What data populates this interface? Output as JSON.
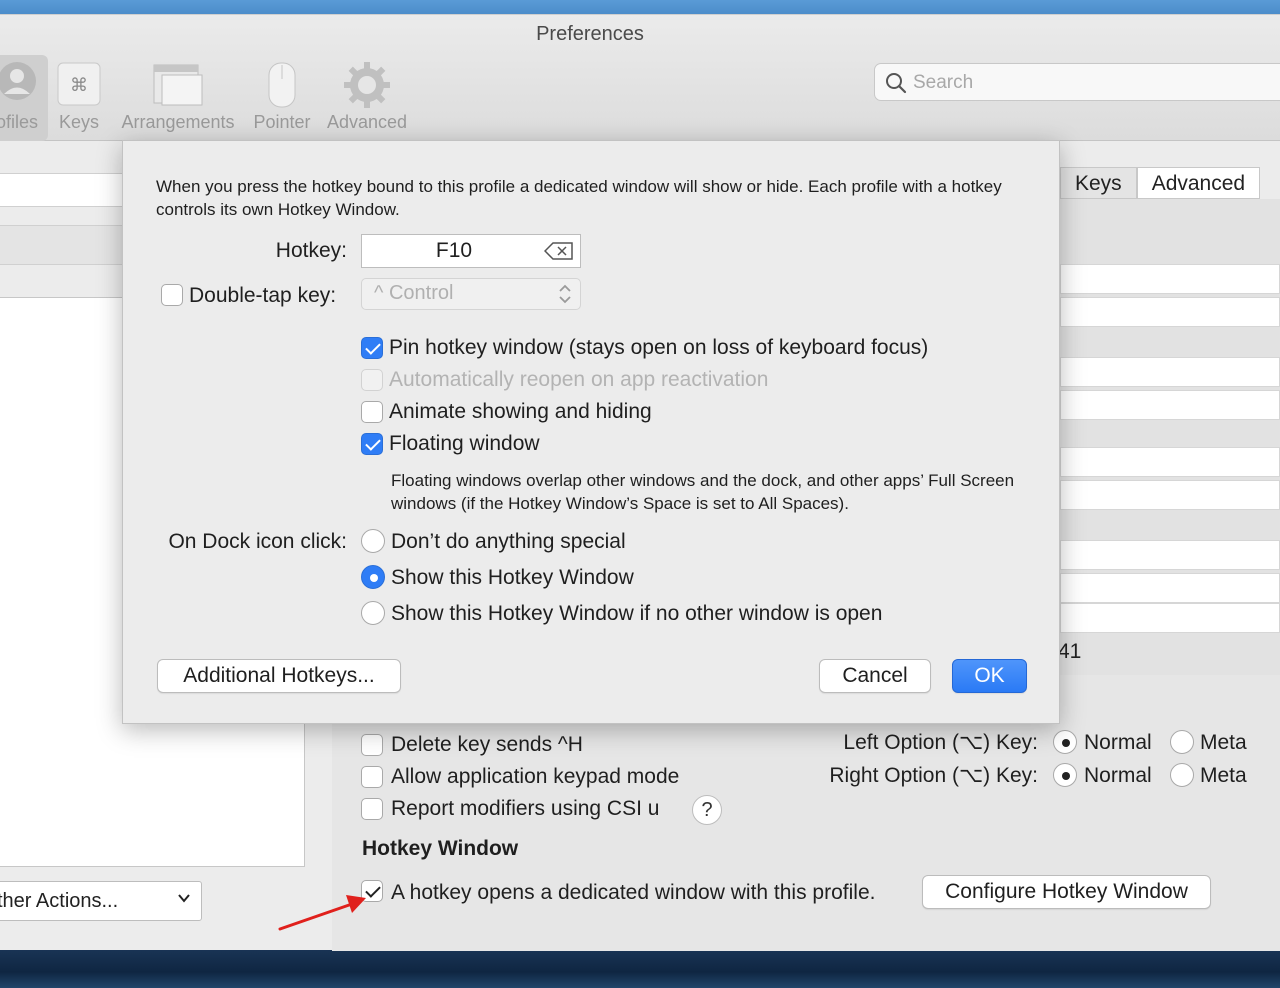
{
  "window": {
    "title": "Preferences"
  },
  "toolbar": {
    "items": [
      {
        "label": "ofiles",
        "icon": "person-icon"
      },
      {
        "label": "Keys",
        "icon": "command-key-icon"
      },
      {
        "label": "Arrangements",
        "icon": "windows-icon"
      },
      {
        "label": "Pointer",
        "icon": "mouse-icon"
      },
      {
        "label": "Advanced",
        "icon": "gear-icon"
      }
    ]
  },
  "search": {
    "placeholder": "Search"
  },
  "sidebar": {
    "other_actions": "ther Actions..."
  },
  "profile_tabs": {
    "keys": "Keys",
    "advanced": "Advanced",
    "partial_value": "41"
  },
  "keys_panel": {
    "delete_key": "Delete key sends ^H",
    "keypad_mode": "Allow application keypad mode",
    "report_modifiers": "Report modifiers using CSI u",
    "help": "?",
    "left_option": "Left Option (⌥) Key:",
    "right_option": "Right Option (⌥) Key:",
    "normal": "Normal",
    "meta": "Meta",
    "hotkey_section": "Hotkey Window",
    "hotkey_opens": "A hotkey opens a dedicated window with this profile.",
    "configure_button": "Configure Hotkey Window"
  },
  "dialog": {
    "description": "When you press the hotkey bound to this profile a dedicated window will show or hide. Each profile with a hotkey controls its own Hotkey Window.",
    "hotkey_label": "Hotkey:",
    "hotkey_value": "F10",
    "double_tap_label": "Double-tap key:",
    "double_tap_value": "^ Control",
    "pin": "Pin hotkey window (stays open on loss of keyboard focus)",
    "reopen": "Automatically reopen on app reactivation",
    "animate": "Animate showing and hiding",
    "floating": "Floating window",
    "floating_note": "Floating windows overlap other windows and the dock, and other apps’ Full Screen windows (if the Hotkey Window’s Space is set to All Spaces).",
    "dock_label": "On Dock icon click:",
    "dock_options": [
      "Don’t do anything special",
      "Show this Hotkey Window",
      "Show this Hotkey Window if no other window is open"
    ],
    "additional_hotkeys": "Additional Hotkeys...",
    "cancel": "Cancel",
    "ok": "OK"
  },
  "colors": {
    "accent": "#2f7df6",
    "annotation_arrow": "#e0201c"
  }
}
